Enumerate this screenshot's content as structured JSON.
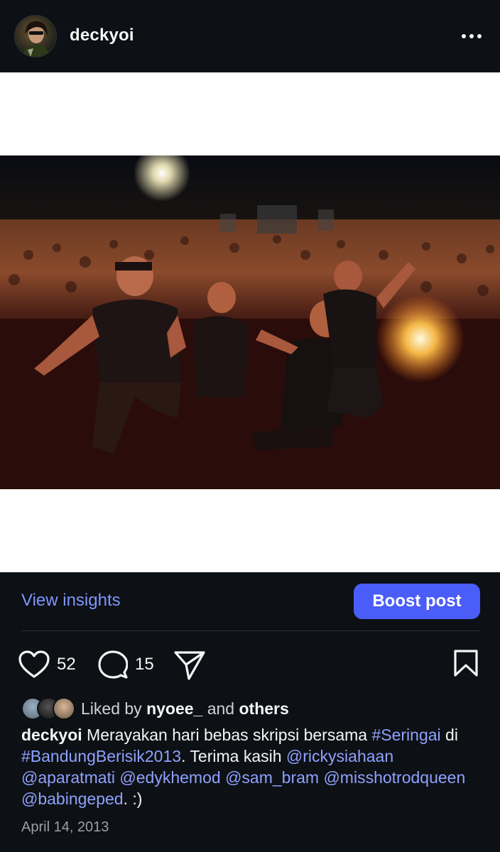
{
  "post": {
    "author": "deckyoi",
    "more_icon": "more-horizontal-icon",
    "media_icon": "photo-concert-stage",
    "view_insights": "View insights",
    "boost_post": "Boost post",
    "like_count": "52",
    "comment_count": "15",
    "liked_by_prefix": "Liked by",
    "liked_by_user": "nyoee_",
    "liked_by_and": "and",
    "liked_by_others": "others",
    "caption": {
      "author": "deckyoi",
      "text1": " Merayakan hari bebas skripsi bersama ",
      "hashtag1": "#Seringai",
      "text2": " di ",
      "hashtag2": "#BandungBerisik2013",
      "text3": ". Terima kasih ",
      "mention1": "@rickysiahaan",
      "mention2": "@aparatmati",
      "mention3": "@edykhemod",
      "mention4": "@sam_bram",
      "mention5": "@misshotrodqueen",
      "mention6": "@babingeped",
      "text4": ". :)"
    },
    "date": "April 14, 2013"
  },
  "colors": {
    "background": "#0d1014",
    "link": "#8ea2ff",
    "accent": "#4a5df9",
    "text": "#f5f5f5",
    "muted": "#9aa0a6"
  }
}
